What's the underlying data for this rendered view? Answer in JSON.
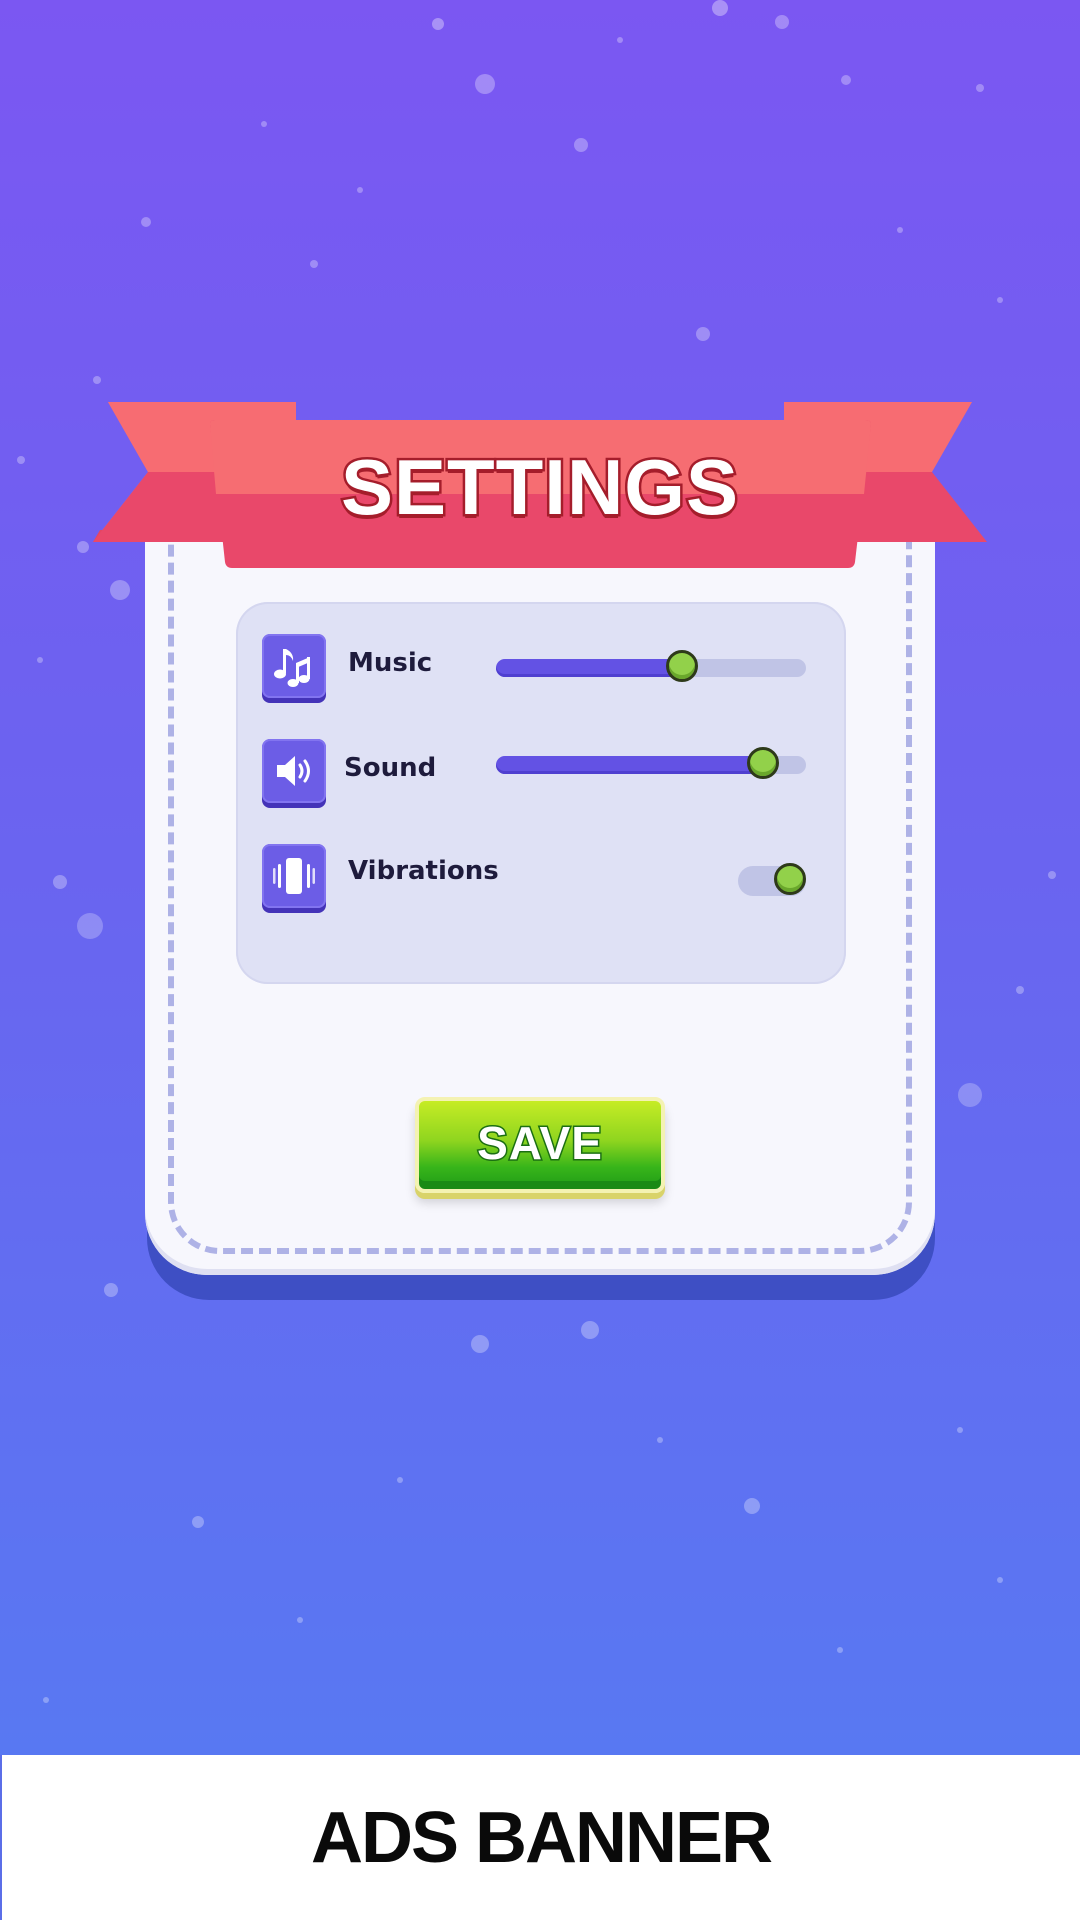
{
  "header": {
    "title": "SETTINGS"
  },
  "settings": [
    {
      "label": "Music",
      "icon": "music-notes-icon",
      "type": "slider",
      "value": 0.6
    },
    {
      "label": "Sound",
      "icon": "speaker-icon",
      "type": "slider",
      "value": 0.86
    },
    {
      "label": "Vibrations",
      "icon": "vibration-icon",
      "type": "toggle",
      "value": true
    }
  ],
  "actions": {
    "save_label": "SAVE"
  },
  "ads": {
    "label": "ADS BANNER"
  },
  "colors": {
    "background_top": "#7b57f2",
    "background_bottom": "#557cf3",
    "ribbon": "#ea4a6a",
    "accent": "#6352e4",
    "knob": "#92d14a",
    "save_button": "#5fc51d"
  }
}
